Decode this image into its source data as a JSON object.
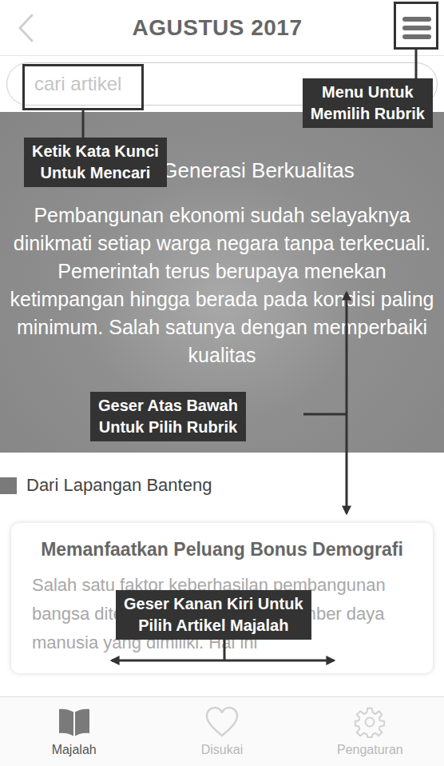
{
  "header": {
    "title": "AGUSTUS 2017"
  },
  "search": {
    "placeholder": "cari artikel"
  },
  "hero": {
    "title": "Generasi Berkualitas",
    "text": "Pembangunan ekonomi sudah selayaknya dinikmati setiap warga negara tanpa terkecuali. Pemerintah terus berupaya menekan ketimpangan hingga berada pada kondisi paling minimum. Salah satunya dengan memperbaiki kualitas"
  },
  "section": {
    "title": "Dari Lapangan Banteng"
  },
  "article": {
    "title": "Memanfaatkan Peluang Bonus Demografi",
    "excerpt": "Salah satu faktor keberhasilan pembangunan bangsa ditentukan oleh kualitas sumber daya manusia yang dimiliki. Hal ini"
  },
  "tabs": [
    {
      "label": "Majalah",
      "selected": true
    },
    {
      "label": "Disukai",
      "selected": false
    },
    {
      "label": "Pengaturan",
      "selected": false
    }
  ],
  "annotations": [
    {
      "lines": [
        "Menu Untuk",
        "Memilih Rubrik"
      ]
    },
    {
      "lines": [
        "Ketik Kata Kunci",
        "Untuk Mencari"
      ]
    },
    {
      "lines": [
        "Geser Atas Bawah",
        "Untuk Pilih Rubrik"
      ]
    },
    {
      "lines": [
        "Geser Kanan Kiri Untuk",
        "Pilih Artikel Majalah"
      ]
    }
  ]
}
